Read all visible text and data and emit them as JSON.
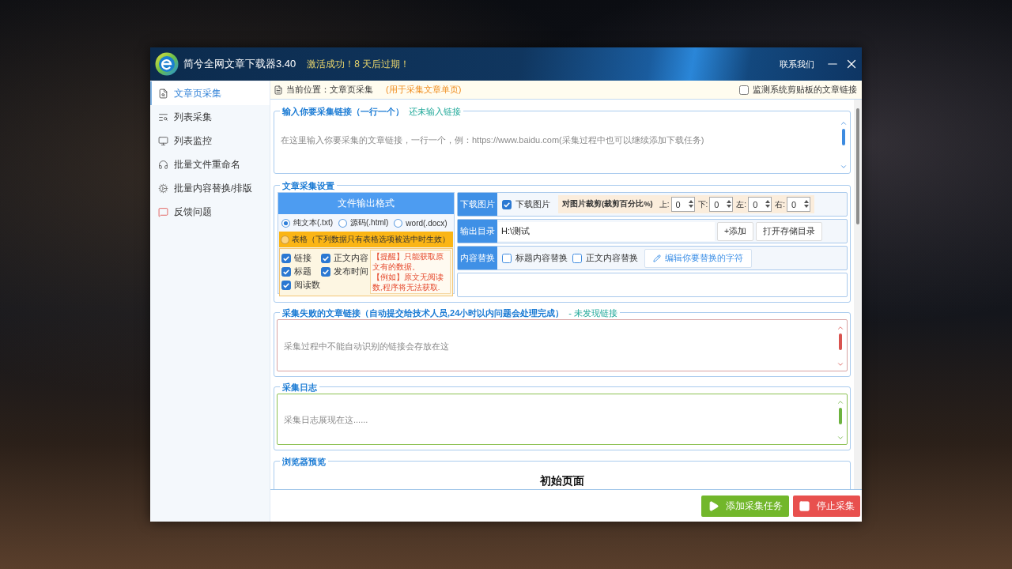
{
  "window": {
    "title": "简兮全网文章下载器3.40",
    "notice": "激活成功！8 天后过期！",
    "contact": "联系我们"
  },
  "sidebar": {
    "items": [
      {
        "label": "文章页采集",
        "selected": true
      },
      {
        "label": "列表采集",
        "selected": false
      },
      {
        "label": "列表监控",
        "selected": false
      },
      {
        "label": "批量文件重命名",
        "selected": false
      },
      {
        "label": "批量内容替换/排版",
        "selected": false
      },
      {
        "label": "反馈问题",
        "selected": false
      }
    ]
  },
  "location_bar": {
    "label": "当前位置：文章页采集",
    "hint": "(用于采集文章单页)",
    "clipboard_monitor": {
      "label": "监测系统剪贴板的文章链接",
      "checked": false
    }
  },
  "link_input": {
    "title": "输入你要采集链接（一行一个）",
    "status": "还未输入链接",
    "placeholder": "在这里输入你要采集的文章链接，一行一个，例：https://www.baidu.com(采集过程中也可以继续添加下载任务)"
  },
  "settings": {
    "title": "文章采集设置",
    "output_format": {
      "title": "文件输出格式",
      "options": [
        {
          "label": "纯文本(.txt)",
          "selected": true
        },
        {
          "label": "源码(.html)",
          "selected": false
        },
        {
          "label": "word(.docx)",
          "selected": false
        }
      ],
      "table_option": {
        "label": "表格（下列数据只有表格选项被选中时生效）",
        "selected": false
      },
      "fields": [
        {
          "label": "链接",
          "checked": true
        },
        {
          "label": "正文内容",
          "checked": true
        },
        {
          "label": "标题",
          "checked": true
        },
        {
          "label": "发布时间",
          "checked": true
        },
        {
          "label": "阅读数",
          "checked": true
        }
      ],
      "notes": [
        "【提醒】只能获取原文有的数据。",
        "【例如】原文无阅读数,程序将无法获取."
      ]
    },
    "download_images": {
      "label": "下载图片",
      "checkbox": {
        "label": "下载图片",
        "checked": true
      },
      "crop": {
        "title": "对图片裁剪(裁剪百分比%)",
        "fields": [
          {
            "label": "上:",
            "value": "0"
          },
          {
            "label": "下:",
            "value": "0"
          },
          {
            "label": "左:",
            "value": "0"
          },
          {
            "label": "右:",
            "value": "0"
          }
        ]
      }
    },
    "output_dir": {
      "label": "输出目录",
      "value": "H:\\测试",
      "buttons": [
        "+添加",
        "打开存储目录"
      ]
    },
    "content_replace": {
      "label": "内容替换",
      "options": [
        {
          "label": "标题内容替换",
          "checked": false
        },
        {
          "label": "正文内容替换",
          "checked": false
        }
      ],
      "edit_button": "编辑你要替换的字符"
    }
  },
  "failed_links": {
    "title": "采集失败的文章链接（自动提交给技术人员,24小时以内问题会处理完成）",
    "status": "- 未发现链接",
    "placeholder": "采集过程中不能自动识别的链接会存放在这"
  },
  "log": {
    "title": "采集日志",
    "placeholder": "采集日志展现在这......"
  },
  "browser_preview": {
    "title": "浏览器预览",
    "content": "初始页面"
  },
  "actions": [
    {
      "label": "添加采集任务",
      "kind": "start"
    },
    {
      "label": "停止采集",
      "kind": "stop"
    }
  ]
}
